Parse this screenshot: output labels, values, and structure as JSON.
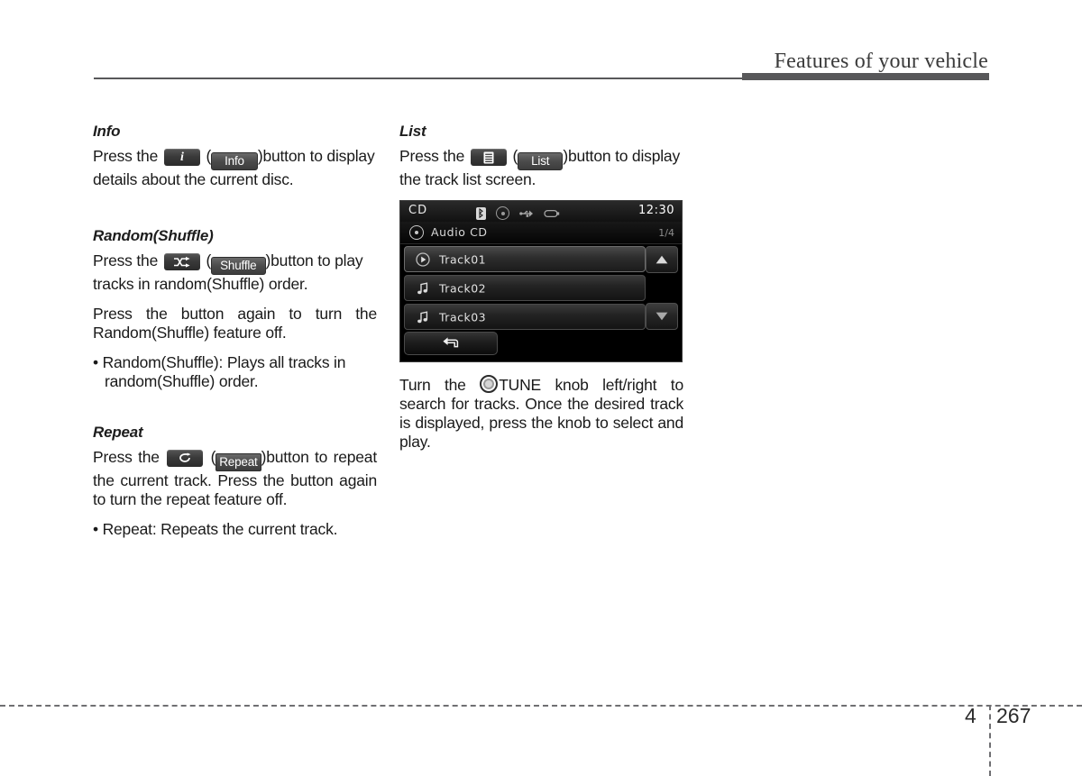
{
  "header": {
    "title": "Features of your vehicle"
  },
  "footer": {
    "chapter": "4",
    "page": "267"
  },
  "left_column": {
    "info": {
      "heading": "Info",
      "key_icon": "info-i-icon",
      "softkey_label": "Info",
      "text_before": "Press the",
      "text_mid": "(",
      "text_after": ")button to display details about the current disc."
    },
    "random": {
      "heading": "Random(Shuffle)",
      "key_icon": "shuffle-icon",
      "softkey_label": "Shuffle",
      "text_before": "Press the",
      "text_mid": "(",
      "text_after": ")button to play tracks in random(Shuffle) order.",
      "paragraph2": "Press the button again to turn the Random(Shuffle) feature off.",
      "bullet": "• Random(Shuffle): Plays all tracks in random(Shuffle) order."
    },
    "repeat": {
      "heading": "Repeat",
      "key_icon": "repeat-icon",
      "softkey_label": "Repeat",
      "text_before": "Press  the",
      "text_mid": "(",
      "text_after": ")button  to repeat  the  current  track.  Press  the button  again  to  turn  the  repeat feature off.",
      "bullet": "• Repeat: Repeats the current track."
    }
  },
  "right_column": {
    "list": {
      "heading": "List",
      "key_icon": "list-lines-icon",
      "softkey_label": "List",
      "text_before": "Press the",
      "text_mid": "(",
      "text_after": ")button to display the track list screen."
    },
    "tune_note": {
      "text_before": "Turn the",
      "knob_icon": "tune-knob-icon",
      "text_after": "TUNE knob left/right to search for tracks. Once the desired track is displayed, press the knob to select and play."
    }
  },
  "head_unit": {
    "status_bar": {
      "source": "CD",
      "clock": "12:30",
      "icons": [
        "bluetooth-icon",
        "disc-icon",
        "usb-icon",
        "aux-jack-icon"
      ]
    },
    "title_bar": {
      "icon": "cd-disc-icon",
      "title": "Audio CD",
      "page_indicator": "1/4"
    },
    "tracks": [
      {
        "label": "Track01",
        "icon": "play-circle-icon",
        "selected": true
      },
      {
        "label": "Track02",
        "icon": "music-note-icon",
        "selected": false
      },
      {
        "label": "Track03",
        "icon": "music-note-icon",
        "selected": false
      }
    ],
    "scroll": {
      "up": "arrow-up-icon",
      "down": "arrow-down-icon"
    },
    "back_button": "back-arrow-icon"
  },
  "colors": {
    "rule": "#58585a",
    "text": "#1a1a1a",
    "screen_bg": "#000000",
    "screen_text": "#e2e2e2"
  }
}
